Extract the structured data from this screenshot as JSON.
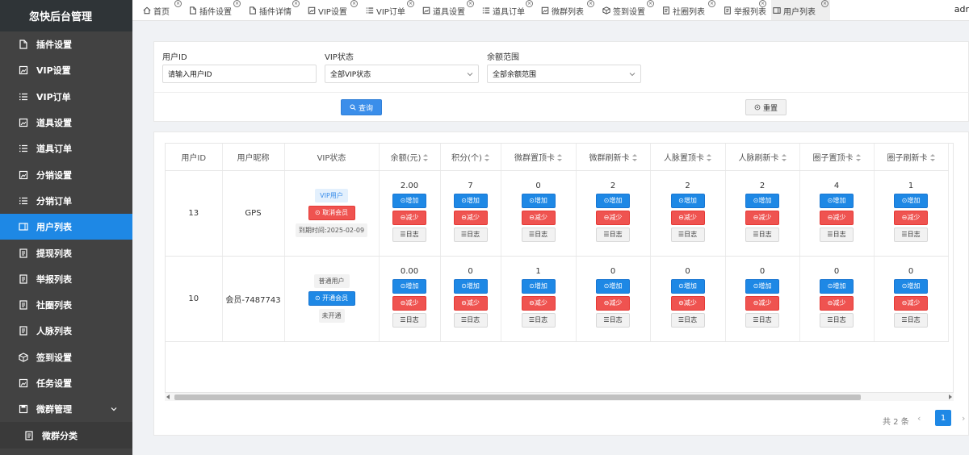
{
  "app": {
    "title": "忽快后台管理",
    "user": "adr"
  },
  "sidebar": {
    "items": [
      {
        "label": "插件设置",
        "icon": "file-icon"
      },
      {
        "label": "VIP设置",
        "icon": "image-icon"
      },
      {
        "label": "VIP订单",
        "icon": "list-icon"
      },
      {
        "label": "道具设置",
        "icon": "image-icon"
      },
      {
        "label": "道具订单",
        "icon": "list-icon"
      },
      {
        "label": "分销设置",
        "icon": "image-icon"
      },
      {
        "label": "分销订单",
        "icon": "list-icon"
      },
      {
        "label": "用户列表",
        "icon": "user-card-icon",
        "active": true
      },
      {
        "label": "提现列表",
        "icon": "document-icon"
      },
      {
        "label": "举报列表",
        "icon": "document-icon"
      },
      {
        "label": "社圈列表",
        "icon": "document-icon"
      },
      {
        "label": "人脉列表",
        "icon": "document-icon"
      },
      {
        "label": "签到设置",
        "icon": "cube-icon"
      },
      {
        "label": "任务设置",
        "icon": "image-icon"
      },
      {
        "label": "微群管理",
        "icon": "save-icon",
        "expandable": true
      },
      {
        "label": "微群分类",
        "icon": "document-icon",
        "sub": true
      }
    ]
  },
  "tabs": [
    {
      "label": "首页",
      "icon": "home-icon"
    },
    {
      "label": "插件设置",
      "icon": "file-icon"
    },
    {
      "label": "插件详情",
      "icon": "file-icon"
    },
    {
      "label": "VIP设置",
      "icon": "image-icon"
    },
    {
      "label": "VIP订单",
      "icon": "list-icon"
    },
    {
      "label": "道具设置",
      "icon": "image-icon"
    },
    {
      "label": "道具订单",
      "icon": "list-icon"
    },
    {
      "label": "微群列表",
      "icon": "image-icon"
    },
    {
      "label": "签到设置",
      "icon": "cube-icon"
    },
    {
      "label": "社圈列表",
      "icon": "document-icon"
    },
    {
      "label": "举报列表",
      "icon": "document-icon"
    },
    {
      "label": "用户列表",
      "icon": "user-card-icon",
      "active": true
    }
  ],
  "filters": {
    "user_id_label": "用户ID",
    "user_id_placeholder": "请输入用户ID",
    "vip_label": "VIP状态",
    "vip_value": "全部VIP状态",
    "balance_label": "余额范围",
    "balance_value": "全部余额范围",
    "search_label": "查询",
    "reset_label": "重置"
  },
  "table": {
    "headers": [
      "用户ID",
      "用户昵称",
      "VIP状态",
      "余额(元)",
      "积分(个)",
      "微群置顶卡",
      "微群刷新卡",
      "人脉置顶卡",
      "人脉刷新卡",
      "圈子置顶卡",
      "圈子刷新卡"
    ],
    "sortable": [
      false,
      false,
      false,
      true,
      true,
      true,
      true,
      true,
      true,
      true,
      true
    ],
    "rows": [
      {
        "id": "13",
        "nickname": "GPS",
        "vip_badge": "VIP用户",
        "vip_action": "取消会员",
        "vip_note": "到期时间:2025-02-09",
        "is_vip": true,
        "values": [
          "2.00",
          "7",
          "0",
          "2",
          "2",
          "2",
          "4",
          "1"
        ]
      },
      {
        "id": "10",
        "nickname": "会员-7487743",
        "vip_badge": "普通用户",
        "vip_action": "开通会员",
        "vip_note": "未开通",
        "is_vip": false,
        "values": [
          "0.00",
          "0",
          "1",
          "0",
          "0",
          "0",
          "0",
          "0"
        ]
      }
    ],
    "btn_add": "增加",
    "btn_sub": "减少",
    "btn_log": "日志"
  },
  "pagination": {
    "total": "共 2 条",
    "current": "1",
    "prev": "‹",
    "next": "›"
  }
}
